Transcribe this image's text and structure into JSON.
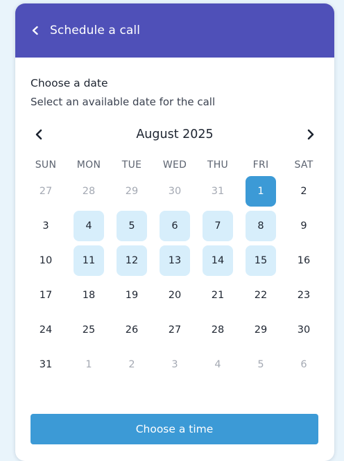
{
  "header": {
    "title": "Schedule a call",
    "background": "#4f50b8"
  },
  "section": {
    "title": "Choose a date",
    "subtitle": "Select an available date for the call"
  },
  "calendar": {
    "month_label": "August 2025",
    "weekdays": [
      "SUN",
      "MON",
      "TUE",
      "WED",
      "THU",
      "FRI",
      "SAT"
    ],
    "days": [
      {
        "label": "27",
        "state": "muted"
      },
      {
        "label": "28",
        "state": "muted"
      },
      {
        "label": "29",
        "state": "muted"
      },
      {
        "label": "30",
        "state": "muted"
      },
      {
        "label": "31",
        "state": "muted"
      },
      {
        "label": "1",
        "state": "selected"
      },
      {
        "label": "2",
        "state": "normal"
      },
      {
        "label": "3",
        "state": "normal"
      },
      {
        "label": "4",
        "state": "available"
      },
      {
        "label": "5",
        "state": "available"
      },
      {
        "label": "6",
        "state": "available"
      },
      {
        "label": "7",
        "state": "available"
      },
      {
        "label": "8",
        "state": "available"
      },
      {
        "label": "9",
        "state": "normal"
      },
      {
        "label": "10",
        "state": "normal"
      },
      {
        "label": "11",
        "state": "available"
      },
      {
        "label": "12",
        "state": "available"
      },
      {
        "label": "13",
        "state": "available"
      },
      {
        "label": "14",
        "state": "available"
      },
      {
        "label": "15",
        "state": "available"
      },
      {
        "label": "16",
        "state": "normal"
      },
      {
        "label": "17",
        "state": "normal"
      },
      {
        "label": "18",
        "state": "normal"
      },
      {
        "label": "19",
        "state": "normal"
      },
      {
        "label": "20",
        "state": "normal"
      },
      {
        "label": "21",
        "state": "normal"
      },
      {
        "label": "22",
        "state": "normal"
      },
      {
        "label": "23",
        "state": "normal"
      },
      {
        "label": "24",
        "state": "normal"
      },
      {
        "label": "25",
        "state": "normal"
      },
      {
        "label": "26",
        "state": "normal"
      },
      {
        "label": "27",
        "state": "normal"
      },
      {
        "label": "28",
        "state": "normal"
      },
      {
        "label": "29",
        "state": "normal"
      },
      {
        "label": "30",
        "state": "normal"
      },
      {
        "label": "31",
        "state": "normal"
      },
      {
        "label": "1",
        "state": "muted"
      },
      {
        "label": "2",
        "state": "muted"
      },
      {
        "label": "3",
        "state": "muted"
      },
      {
        "label": "4",
        "state": "muted"
      },
      {
        "label": "5",
        "state": "muted"
      },
      {
        "label": "6",
        "state": "muted"
      }
    ],
    "colors": {
      "selected": "#3c9ad6",
      "available": "#d7eefb",
      "muted_text": "#a4a9b3"
    }
  },
  "cta": {
    "label": "Choose a time",
    "background": "#3c9ad6"
  },
  "icons": {
    "back": "chevron-left-icon",
    "prev_month": "chevron-left-icon",
    "next_month": "chevron-right-icon"
  }
}
